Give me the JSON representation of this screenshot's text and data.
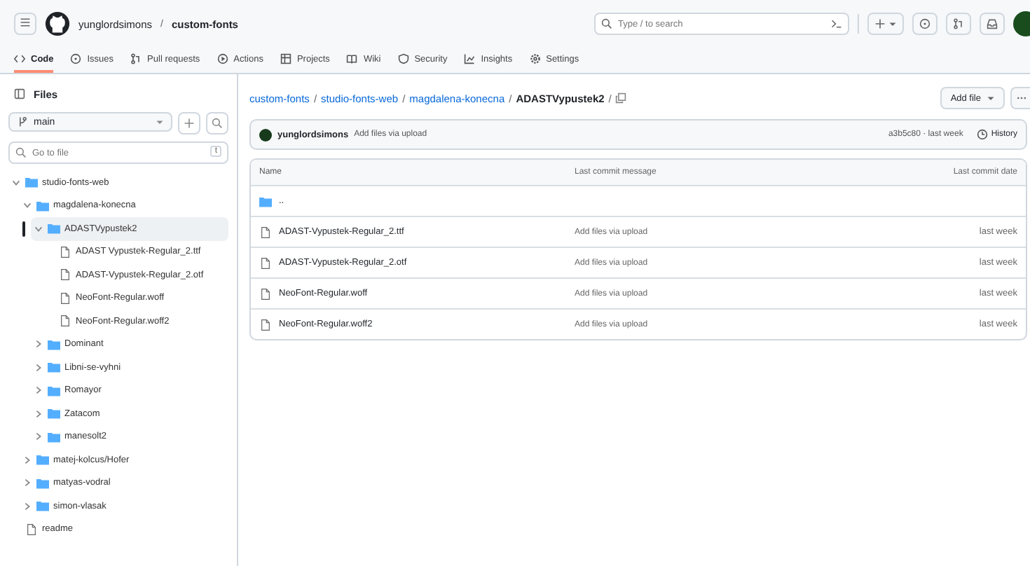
{
  "header": {
    "owner": "yunglordsimons",
    "separator": "/",
    "repo": "custom-fonts",
    "search": {
      "placeholder": "Type / to search"
    }
  },
  "tabs": [
    {
      "label": "Code",
      "selected": true
    },
    {
      "label": "Issues",
      "selected": false
    },
    {
      "label": "Pull requests",
      "selected": false
    },
    {
      "label": "Actions",
      "selected": false
    },
    {
      "label": "Projects",
      "selected": false
    },
    {
      "label": "Wiki",
      "selected": false
    },
    {
      "label": "Security",
      "selected": false
    },
    {
      "label": "Insights",
      "selected": false
    },
    {
      "label": "Settings",
      "selected": false
    }
  ],
  "sidebar": {
    "title": "Files",
    "branch": "main",
    "filter": {
      "placeholder": "Go to file",
      "key": "t"
    },
    "tree": [
      {
        "name": "studio-fonts-web",
        "kind": "folder",
        "expanded": true,
        "selected": false,
        "children": [
          {
            "name": "magdalena-konecna",
            "kind": "folder",
            "expanded": true,
            "selected": false,
            "children": [
              {
                "name": "ADASTVypustek2",
                "kind": "folder",
                "expanded": true,
                "selected": true,
                "children": [
                  {
                    "name": "ADAST Vypustek-Regular_2.ttf",
                    "kind": "file",
                    "selected": false
                  },
                  {
                    "name": "ADAST-Vypustek-Regular_2.otf",
                    "kind": "file",
                    "selected": false
                  },
                  {
                    "name": "NeoFont-Regular.woff",
                    "kind": "file",
                    "selected": false
                  },
                  {
                    "name": "NeoFont-Regular.woff2",
                    "kind": "file",
                    "selected": false
                  }
                ]
              },
              {
                "name": "Dominant",
                "kind": "folder",
                "expanded": false,
                "selected": false
              },
              {
                "name": "Libni-se-vyhni",
                "kind": "folder",
                "expanded": false,
                "selected": false
              },
              {
                "name": "Romayor",
                "kind": "folder",
                "expanded": false,
                "selected": false
              },
              {
                "name": "Zatacom",
                "kind": "folder",
                "expanded": false,
                "selected": false
              },
              {
                "name": "manesolt2",
                "kind": "folder",
                "expanded": false,
                "selected": false
              }
            ]
          },
          {
            "name": "matej-kolcus/Hofer",
            "kind": "folder",
            "expanded": false,
            "selected": false
          },
          {
            "name": "matyas-vodral",
            "kind": "folder",
            "expanded": false,
            "selected": false
          },
          {
            "name": "simon-vlasak",
            "kind": "folder",
            "expanded": false,
            "selected": false
          }
        ]
      },
      {
        "name": "readme",
        "kind": "file",
        "selected": false
      }
    ]
  },
  "breadcrumb": [
    {
      "kind": "link",
      "text": "custom-fonts"
    },
    {
      "kind": "separator",
      "text": "/"
    },
    {
      "kind": "link",
      "text": "studio-fonts-web"
    },
    {
      "kind": "separator",
      "text": "/"
    },
    {
      "kind": "link",
      "text": "magdalena-konecna"
    },
    {
      "kind": "separator",
      "text": "/"
    },
    {
      "kind": "current",
      "text": "ADASTVypustek2"
    },
    {
      "kind": "separator",
      "text": "/"
    }
  ],
  "add_file": "Add file",
  "commit": {
    "author": "yunglordsimons",
    "message": "Add files via upload",
    "meta": "a3b5c80 · last week",
    "history": "History"
  },
  "table": {
    "columns": [
      "Name",
      "Last commit message",
      "Last commit date"
    ],
    "rows": [
      {
        "kind": "parent",
        "name": ".."
      },
      {
        "kind": "file",
        "name": "ADAST-Vypustek-Regular_2.ttf",
        "message": "Add files via upload",
        "date": "last week"
      },
      {
        "kind": "file",
        "name": "ADAST-Vypustek-Regular_2.otf",
        "message": "Add files via upload",
        "date": "last week"
      },
      {
        "kind": "file",
        "name": "NeoFont-Regular.woff",
        "message": "Add files via upload",
        "date": "last week"
      },
      {
        "kind": "file",
        "name": "NeoFont-Regular.woff2",
        "message": "Add files via upload",
        "date": "last week"
      }
    ]
  }
}
